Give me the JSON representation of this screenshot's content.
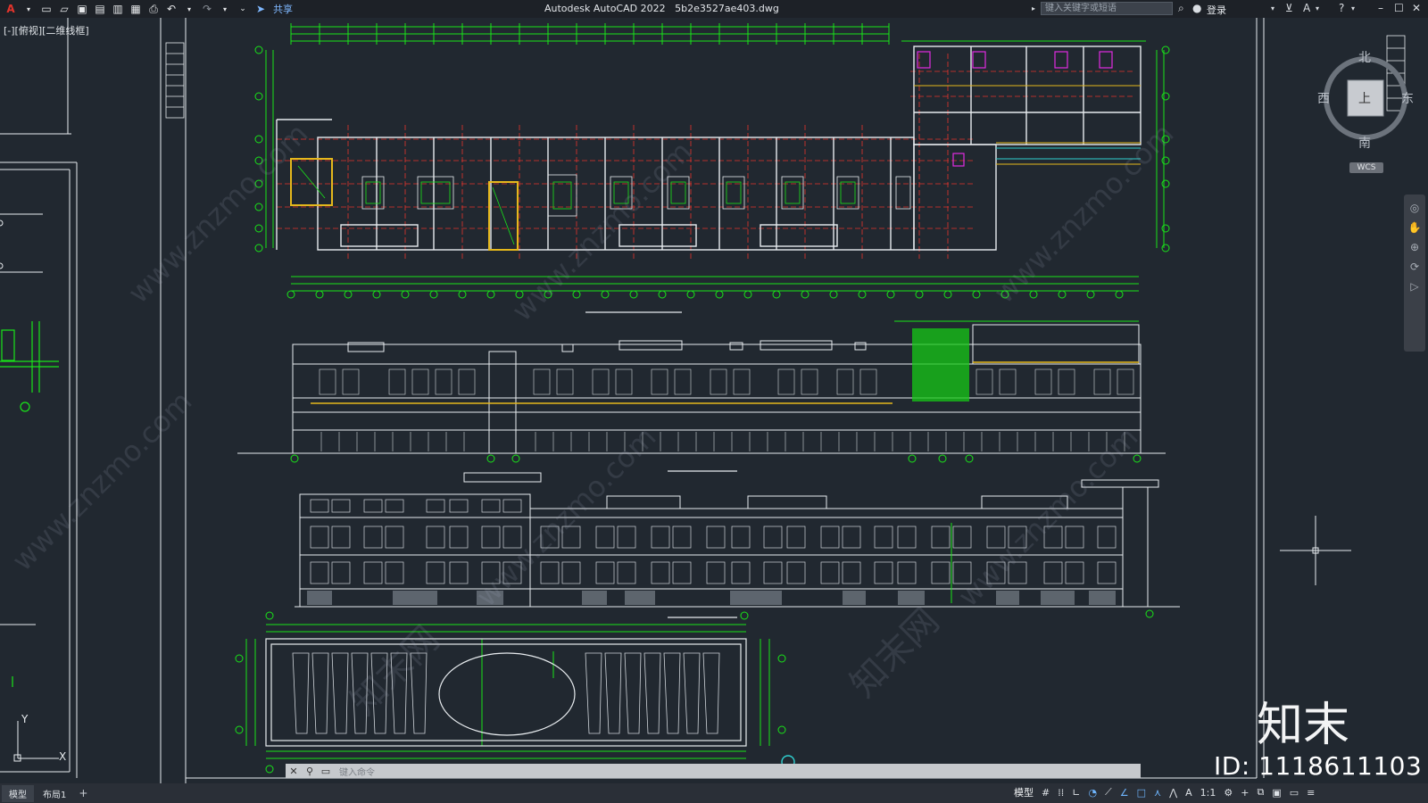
{
  "app": {
    "logo_letter": "A",
    "title": "Autodesk AutoCAD 2022",
    "filename": "5b2e3527ae403.dwg",
    "share_label": "共享",
    "search_placeholder": "键入关键字或短语",
    "login_label": "登录"
  },
  "viewport": {
    "label": "[-][俯视][二维线框]"
  },
  "navcube": {
    "north": "北",
    "south": "南",
    "west": "西",
    "east": "东",
    "face": "上",
    "wcs": "WCS"
  },
  "command": {
    "placeholder": "键入命令"
  },
  "tabs": [
    {
      "label": "模型",
      "active": true
    },
    {
      "label": "布局1",
      "active": false
    }
  ],
  "status": {
    "model_label": "模型",
    "scale": "1:1"
  },
  "overlay": {
    "brand": "知末",
    "id_text": "ID: 1118611103",
    "watermark": "www.znzmo.com",
    "watermark2": "知末网"
  },
  "colors": {
    "background": "#212830",
    "line_white": "#e8ecef",
    "dim_green": "#19e519",
    "axis_red": "#e5352d",
    "highlight_yellow": "#e5b81c",
    "magenta": "#e02be0",
    "cyan": "#30d0d0"
  }
}
